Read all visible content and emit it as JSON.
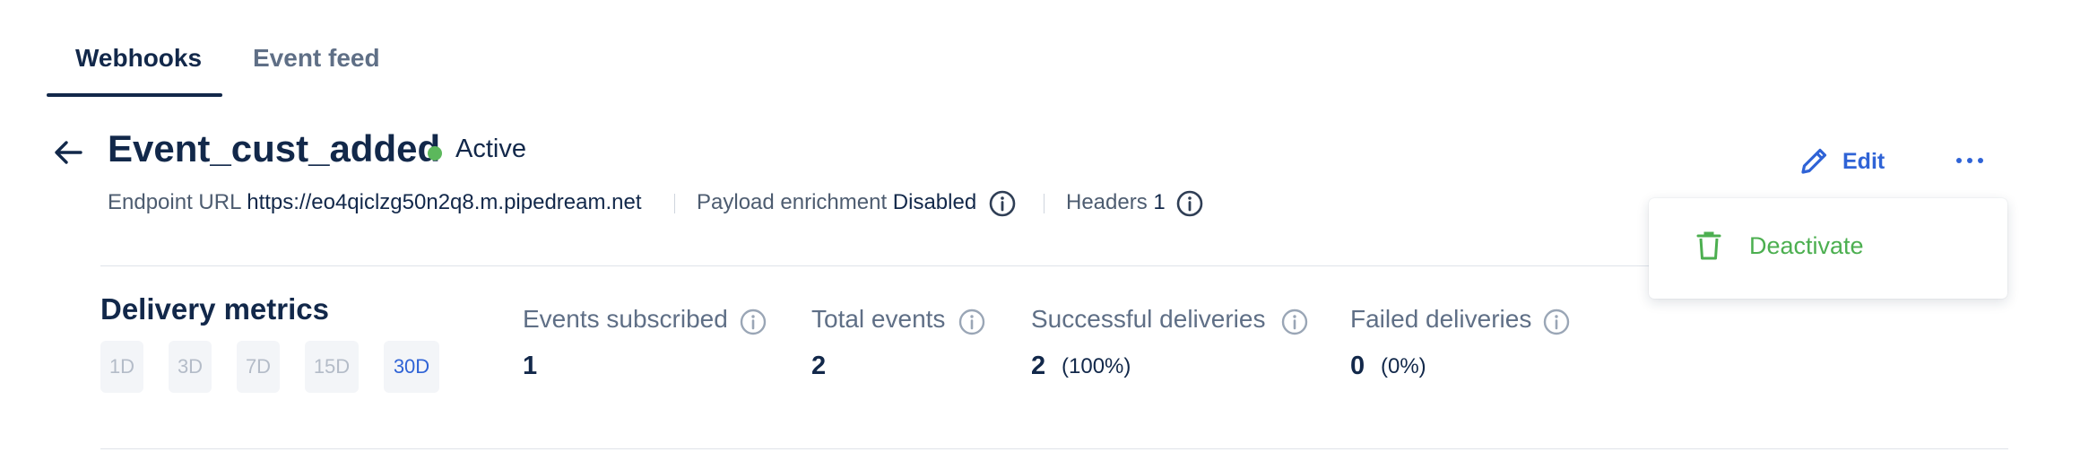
{
  "tabs": [
    {
      "label": "Webhooks",
      "active": true
    },
    {
      "label": "Event feed",
      "active": false
    }
  ],
  "header": {
    "title": "Event_cust_added",
    "status": {
      "label": "Active",
      "color": "#5cb85c"
    }
  },
  "meta": {
    "endpoint_label": "Endpoint URL",
    "endpoint_value": "https://eo4qiclzg50n2q8.m.pipedream.net",
    "payload_label": "Payload enrichment",
    "payload_value": "Disabled",
    "headers_label": "Headers",
    "headers_value": "1"
  },
  "actions": {
    "edit_label": "Edit",
    "more_icon": "more-horizontal-icon",
    "menu": [
      {
        "label": "Deactivate",
        "icon": "trash-icon",
        "color": "#4caf50"
      }
    ]
  },
  "metrics": {
    "title": "Delivery metrics",
    "ranges": [
      {
        "label": "1D",
        "active": false
      },
      {
        "label": "3D",
        "active": false
      },
      {
        "label": "7D",
        "active": false
      },
      {
        "label": "15D",
        "active": false
      },
      {
        "label": "30D",
        "active": true
      }
    ],
    "items": [
      {
        "label": "Events subscribed",
        "value": "1",
        "percent": ""
      },
      {
        "label": "Total events",
        "value": "2",
        "percent": ""
      },
      {
        "label": "Successful deliveries",
        "value": "2",
        "percent": "(100%)"
      },
      {
        "label": "Failed deliveries",
        "value": "0",
        "percent": "(0%)"
      }
    ]
  },
  "colors": {
    "accent": "#2f63d6",
    "primary_text": "#12284a",
    "success": "#4caf50"
  }
}
